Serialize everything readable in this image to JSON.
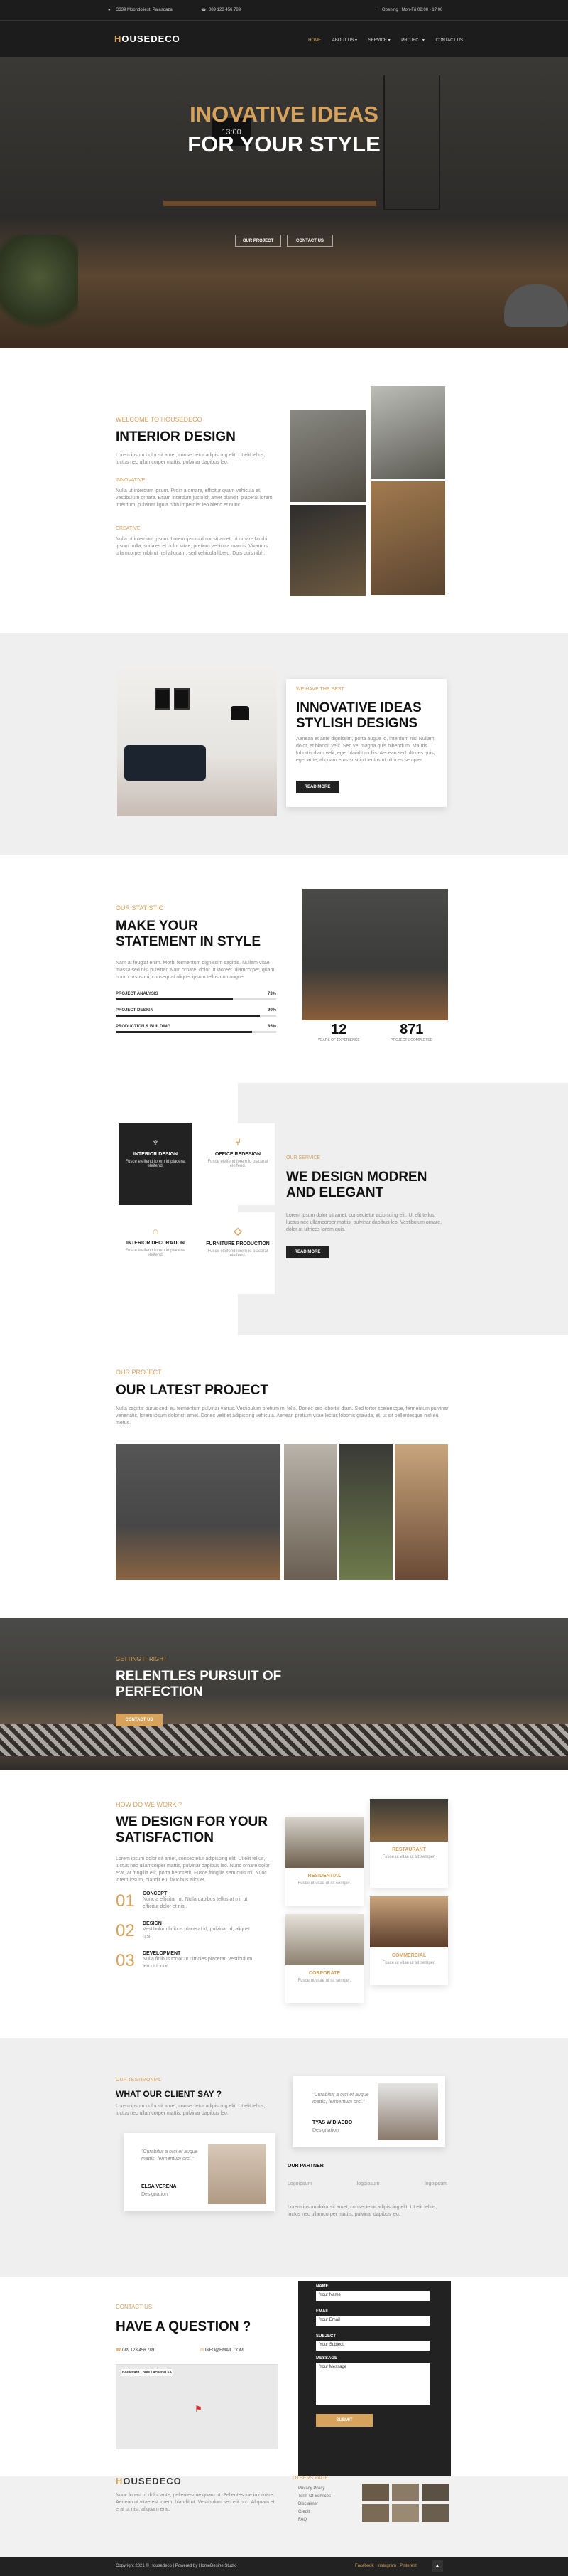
{
  "topbar": {
    "address": "C339 Moondoliest, Palasdaza",
    "phone": "089 123 456 789",
    "hours": "Opening : Mon-Fri 08:00 - 17:00"
  },
  "nav": {
    "logo_main": "OUSEDECO",
    "logo_first": "H",
    "items": [
      "HOME",
      "ABOUT US ▾",
      "SERVICE ▾",
      "PROJECT ▾",
      "CONTACT US"
    ]
  },
  "hero": {
    "title1": "INOVATIVE IDEAS",
    "title2": "FOR YOUR STYLE",
    "btn1": "OUR PROJECT",
    "btn2": "CONTACT US",
    "clock": "13:00"
  },
  "welcome": {
    "kicker": "WELCOME TO HOUSEDECO",
    "title": "INTERIOR DESIGN",
    "intro": "Lorem ipsum dolor sit amet, consectetur adipiscing elit. Ut elit tellus, luctus nec ullamcorper mattis, pulvinar dapibus leo.",
    "sub1": "INNOVATIVE",
    "text1": "Nulla ut interdum ipsum. Proin a ornare, efficitur quam vehicula et, vestibulum ornare. Etiam interdum justo sit amet blandit, placerat lorem interdum, pulvinar ligula nibh imperdiet leo blend et nunc.",
    "sub2": "CREATIVE",
    "text2": "Nulla ut interdum ipsum. Lorem ipsum dolor sit amet, ut ornare Morbi ipsum nulla, sodales et dolor vitae, pretium vehicula mauris. Vivamus ullamcorper nibh ut nisl aliquam, sed vehicula libero. Duis quis nibh."
  },
  "best": {
    "kicker": "WE HAVE THE BEST",
    "title": "INNOVATIVE IDEAS STYLISH DESIGNS",
    "text": "Aenean et ante dignissim, porta augue id, interdum nisi Nullam dolor, et blandit velit. Sed vel magna quis bibendum. Mauris lobortis diam velit, eget blandit mollis. Aenean sed ultrices quis, eget ante, aliquam eros suscipit lectus ut ultrices sempler.",
    "button": "READ MORE"
  },
  "statistic": {
    "kicker": "OUR STATISTIC",
    "title": "MAKE YOUR STATEMENT IN STYLE",
    "text": "Nam at feugiat enim. Morbi fermentum dignissim sagittis. Nullam vitae massa sed nisl pulvinar. Nam ornare, dolor ut laoreet ullamcorper, quam nunc cursus mi, consequat aliquet ipsum tellus non augue.",
    "bars": [
      {
        "label": "PROJECT ANALYSIS",
        "pct_label": "73%",
        "pct": 73
      },
      {
        "label": "PROJECT DESIGN",
        "pct_label": "90%",
        "pct": 90
      },
      {
        "label": "PRODUCTION & BUILDING",
        "pct_label": "85%",
        "pct": 85
      }
    ],
    "counters": [
      {
        "value": "12",
        "label": "YEARS OF EXPERIENCE"
      },
      {
        "value": "871",
        "label": "PROJECTS COMPLETED"
      }
    ]
  },
  "services": {
    "items": [
      {
        "title": "INTERIOR DESIGN",
        "desc": "Fusce eleifend lorem id placerat eleifend."
      },
      {
        "title": "OFFICE REDESIGN",
        "desc": "Fusce eleifend lorem id placerat eleifend."
      },
      {
        "title": "INTERIOR DECORATION",
        "desc": "Fusce eleifend lorem id placerat eleifend."
      },
      {
        "title": "FURNITURE PRODUCTION",
        "desc": "Fusce eleifend lorem id placerat eleifend."
      }
    ],
    "kicker": "OUR SERVICE",
    "title": "WE DESIGN MODREN AND ELEGANT",
    "text": "Lorem ipsum dolor sit amet, consectetur adipiscing elit. Ut elit tellus, luctus nec ullamcorper mattis, pulvinar dapibus leo. Vestibulum ornare, dolor at ultrices lorem quis.",
    "button": "READ MORE"
  },
  "project": {
    "kicker": "OUR PROJECT",
    "title": "OUR LATEST PROJECT",
    "text": "Nulla sagittis purus sed, eu fermentum pulvinar varius. Vestibulum pretium mi felis. Donec sed lobortis diam. Sed tortor scelerisque, fermentum pulvinar venenatis, lorem ipsum dolor sit amet. Donec velit et adipiscing vehicula. Aenean pretium vitae lectus lobortis gravida, et, ut sit pellentesque nisl eu metus."
  },
  "getting": {
    "kicker": "GETTING IT RIGHT",
    "title": "RELENTLES PURSUIT OF PERFECTION",
    "button": "CONTACT US"
  },
  "work": {
    "kicker": "HOW DO WE WORK ?",
    "title": "WE DESIGN FOR YOUR SATISFACTION",
    "text": "Lorem ipsum dolor sit amet, consectetur adipiscing elit. Ut elit tellus, luctus nec ullamcorper mattis, pulvinar dapibus leo. Nunc ornare dolor erat, at fringilla elit, porta hendrerit. Fusce fringilla sem quis mi. Nunc lorem ipsum, blandit eu, faucibus aliquet.",
    "steps": [
      {
        "num": "01",
        "title": "CONCEPT",
        "desc": "Nunc a efficitur mi. Nulla dapibus tellus at mi, ut efficitur dolor et nisi."
      },
      {
        "num": "02",
        "title": "DESIGN",
        "desc": "Vestibulum finibus placerat id, pulvinar id, aliquet nisi."
      },
      {
        "num": "03",
        "title": "DEVELOPMENT",
        "desc": "Nulla finibus tortor ut ultricies placerat, vestibulum leo ut tortor."
      }
    ],
    "cards": [
      {
        "title": "RESIDENTIAL",
        "desc": "Fusce ut vitae ut sit semper."
      },
      {
        "title": "RESTAURANT",
        "desc": "Fusce ut vitae ut sit semper."
      },
      {
        "title": "CORPORATE",
        "desc": "Fusce ut vitae ut sit semper."
      },
      {
        "title": "COMMERCIAL",
        "desc": "Fusce ut vitae ut sit semper."
      }
    ]
  },
  "testimonial": {
    "kicker": "OUR TESTIMONIAL",
    "title": "WHAT OUR CLIENT SAY ?",
    "text": "Lorem ipsum dolor sit amet, consectetur adipiscing elit. Ut elit tellus, luctus nec ullamcorper mattis, pulvinar dapibus leo.",
    "quote1": "\"Curabitur a orci et augue mattis, fermentum orci.\"",
    "name1": "ELSA VERENA",
    "role1": "Designation",
    "quote2": "\"Curabitur a orci et augue mattis, fermentum orci.\"",
    "name2": "TYAS WIDIADDO",
    "role2": "Designation",
    "partner_kicker": "OUR PARTNER",
    "partners": [
      "Logoipsum",
      "logoipsum",
      "logoipsum"
    ],
    "partner_text": "Lorem ipsum dolor sit amet, consectetur adipiscing elit. Ut elit tellus, luctus nec ullamcorper mattis, pulvinar dapibus leo."
  },
  "contact": {
    "kicker": "CONTACT US",
    "title": "HAVE A QUESTION ?",
    "phone": "089 123 456 789",
    "email": "INFO@EMAIL.COM",
    "map_label": "Boulevard Louis Lachenal 6A",
    "labels": [
      "NAME",
      "EMAIL",
      "SUBJECT",
      "MESSAGE"
    ],
    "placeholders": [
      "Your Name",
      "Your Email",
      "Your Subject",
      "Your Message"
    ],
    "button": "SUBMIT"
  },
  "footer": {
    "logo": "OUSEDECO",
    "logo_first": "H",
    "text": "Nunc lorem ut dolor ante, pellentesque quam ut. Pellentesque in ornare. Aenean ut vitae est lorem, blandit ut. Vestibulum sed elit orci. Aliquam et erat ut nisl, aliquam erat.",
    "kicker": "OTHERS PAGE",
    "links": [
      "Privacy Policy",
      "Term Of Services",
      "Disclaimer",
      "Credit",
      "FAQ"
    ],
    "copyright": "Copyright 2021 © Housedeco | Powered by HomeDesine Studio",
    "social": [
      "Facebook",
      "Instagram",
      "Pinterest"
    ]
  }
}
